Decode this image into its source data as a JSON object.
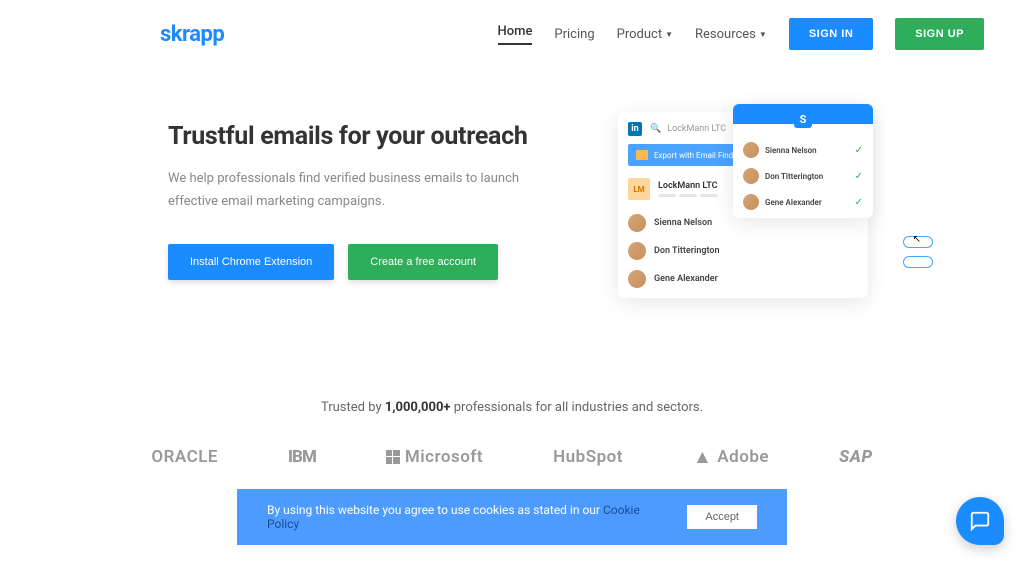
{
  "logo": "skrapp",
  "nav": {
    "home": "Home",
    "pricing": "Pricing",
    "product": "Product",
    "resources": "Resources",
    "signin": "SIGN IN",
    "signup": "SIGN UP"
  },
  "hero": {
    "title": "Trustful emails for your outreach",
    "subtitle": "We help professionals find verified business emails to launch effective email marketing campaigns.",
    "cta_install": "Install Chrome Extension",
    "cta_create": "Create a free account"
  },
  "mockup": {
    "search": "LockMann LTC",
    "export": "Export with Email Finder",
    "company_badge": "LM",
    "company_name": "LockMann LTC",
    "people": [
      "Sienna Nelson",
      "Don Titterington",
      "Gene Alexander"
    ]
  },
  "trusted": {
    "prefix": "Trusted by ",
    "count": "1,000,000+",
    "suffix": " professionals for all industries and sectors.",
    "brands": [
      "ORACLE",
      "IBM",
      "Microsoft",
      "HubSpot",
      "Adobe",
      "SAP"
    ]
  },
  "cookie": {
    "text": "By using this website you agree to use cookies as stated in our ",
    "link": "Cookie Policy",
    "accept": "Accept"
  }
}
